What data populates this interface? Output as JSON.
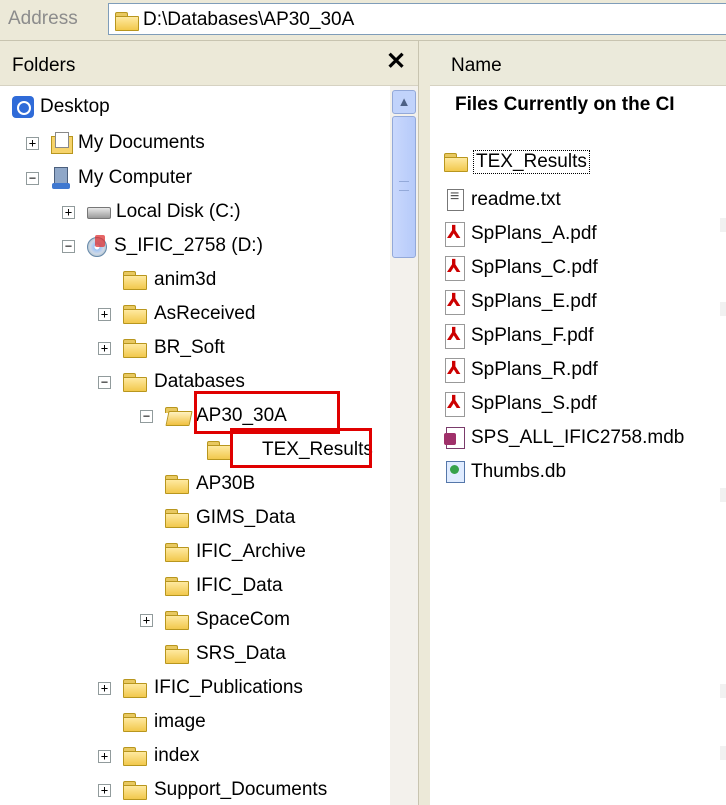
{
  "address_bar": {
    "label": "Address",
    "path": "D:\\Databases\\AP30_30A"
  },
  "folders_pane": {
    "title": "Folders",
    "close": "✕"
  },
  "columns": {
    "name": "Name"
  },
  "tree": [
    {
      "label": "Desktop",
      "expander": ""
    },
    {
      "label": "My Documents",
      "expander": "+"
    },
    {
      "label": "My Computer",
      "expander": "−"
    },
    {
      "label": "Local Disk (C:)",
      "expander": "+"
    },
    {
      "label": "S_IFIC_2758 (D:)",
      "expander": "−"
    },
    {
      "label": "anim3d",
      "expander": ""
    },
    {
      "label": "AsReceived",
      "expander": "+"
    },
    {
      "label": "BR_Soft",
      "expander": "+"
    },
    {
      "label": "Databases",
      "expander": "−"
    },
    {
      "label": "AP30_30A",
      "expander": "−"
    },
    {
      "label": "TEX_Results",
      "expander": ""
    },
    {
      "label": "AP30B",
      "expander": ""
    },
    {
      "label": "GIMS_Data",
      "expander": ""
    },
    {
      "label": "IFIC_Archive",
      "expander": ""
    },
    {
      "label": "IFIC_Data",
      "expander": ""
    },
    {
      "label": "SpaceCom",
      "expander": "+"
    },
    {
      "label": "SRS_Data",
      "expander": ""
    },
    {
      "label": "IFIC_Publications",
      "expander": "+"
    },
    {
      "label": "image",
      "expander": ""
    },
    {
      "label": "index",
      "expander": "+"
    },
    {
      "label": "Support_Documents",
      "expander": "+"
    }
  ],
  "file_list": {
    "heading": "Files Currently on the CI",
    "files": [
      {
        "name": "TEX_Results",
        "icon": "folder-icon"
      },
      {
        "name": "readme.txt",
        "icon": "text-file-icon"
      },
      {
        "name": "SpPlans_A.pdf",
        "icon": "pdf-icon"
      },
      {
        "name": "SpPlans_C.pdf",
        "icon": "pdf-icon"
      },
      {
        "name": "SpPlans_E.pdf",
        "icon": "pdf-icon"
      },
      {
        "name": "SpPlans_F.pdf",
        "icon": "pdf-icon"
      },
      {
        "name": "SpPlans_R.pdf",
        "icon": "pdf-icon"
      },
      {
        "name": "SpPlans_S.pdf",
        "icon": "pdf-icon"
      },
      {
        "name": "SPS_ALL_IFIC2758.mdb",
        "icon": "access-db-icon"
      },
      {
        "name": "Thumbs.db",
        "icon": "thumbs-db-icon"
      }
    ]
  },
  "colors": {
    "highlight_box": "#e00000",
    "chrome": "#ece9d8"
  }
}
